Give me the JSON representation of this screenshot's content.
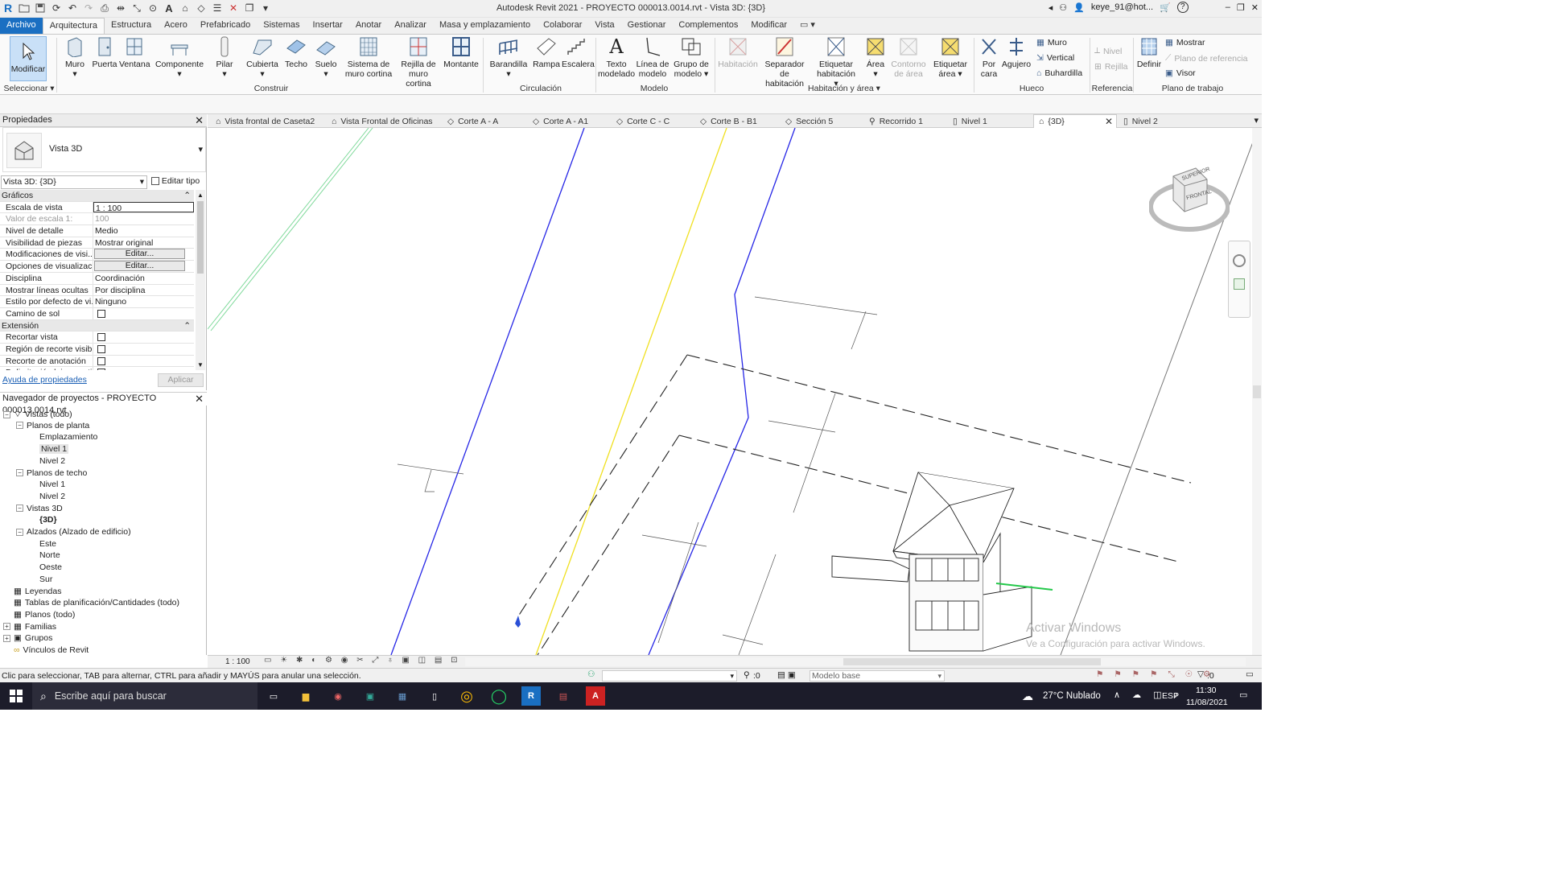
{
  "window": {
    "title": "Autodesk Revit 2021 - PROYECTO 000013.0014.rvt - Vista 3D: {3D}",
    "user": "keye_91@hot..."
  },
  "menu_tabs": [
    "Archivo",
    "Arquitectura",
    "Estructura",
    "Acero",
    "Prefabricado",
    "Sistemas",
    "Insertar",
    "Anotar",
    "Analizar",
    "Masa y emplazamiento",
    "Colaborar",
    "Vista",
    "Gestionar",
    "Complementos",
    "Modificar"
  ],
  "ribbon": {
    "modificar": "Modificar",
    "seleccionar": "Seleccionar",
    "construir": {
      "label": "Construir",
      "items": [
        "Muro",
        "Puerta",
        "Ventana",
        "Componente",
        "Pilar",
        "Cubierta",
        "Techo",
        "Suelo",
        "Sistema de muro cortina",
        "Rejilla de muro cortina",
        "Montante"
      ]
    },
    "circulacion": {
      "label": "Circulación",
      "items": [
        "Barandilla",
        "Rampa",
        "Escalera"
      ]
    },
    "modelo": {
      "label": "Modelo",
      "items": [
        "Texto modelado",
        "Línea de modelo",
        "Grupo de modelo"
      ]
    },
    "habitacion": {
      "label": "Habitación y área",
      "items": [
        "Habitación",
        "Separador de habitación",
        "Etiquetar habitación",
        "Área",
        "Contorno de área",
        "Etiquetar área"
      ]
    },
    "hueco": {
      "label": "Hueco",
      "items": [
        "Por cara",
        "Agujero"
      ],
      "small": [
        "Muro",
        "Vertical",
        "Buhardilla"
      ]
    },
    "referencia": {
      "label": "Referencia",
      "small": [
        "Nivel",
        "Rejilla"
      ]
    },
    "plano": {
      "label": "Plano de trabajo",
      "definir": "Definir",
      "small": [
        "Mostrar",
        "Plano de referencia",
        "Visor"
      ]
    }
  },
  "properties": {
    "header": "Propiedades",
    "type_name": "Vista 3D",
    "view_selector": "Vista 3D: {3D}",
    "edit_type": "Editar tipo",
    "help": "Ayuda de propiedades",
    "apply": "Aplicar",
    "rows": [
      {
        "cat": "Gráficos"
      },
      {
        "k": "Escala de vista",
        "v": "1 : 100"
      },
      {
        "k": "Valor de escala    1:",
        "v": "100",
        "dis": true
      },
      {
        "k": "Nivel de detalle",
        "v": "Medio"
      },
      {
        "k": "Visibilidad de piezas",
        "v": "Mostrar original"
      },
      {
        "k": "Modificaciones de visi...",
        "btn": "Editar..."
      },
      {
        "k": "Opciones de visualizaci...",
        "btn": "Editar..."
      },
      {
        "k": "Disciplina",
        "v": "Coordinación"
      },
      {
        "k": "Mostrar líneas ocultas",
        "v": "Por disciplina"
      },
      {
        "k": "Estilo por defecto de vi...",
        "v": "Ninguno"
      },
      {
        "k": "Camino de sol",
        "cb": true
      },
      {
        "cat": "Extensión"
      },
      {
        "k": "Recortar vista",
        "cb": true
      },
      {
        "k": "Región de recorte visible",
        "cb": true
      },
      {
        "k": "Recorte de anotación",
        "cb": true
      },
      {
        "k": "Delimitación lejana acti...",
        "cb": true
      }
    ]
  },
  "browser": {
    "header": "Navegador de proyectos - PROYECTO 000013.0014.rvt",
    "nodes": [
      {
        "label": "Vistas (todo)",
        "depth": 0,
        "tog": "-",
        "icon": "views"
      },
      {
        "label": "Planos de planta",
        "depth": 1,
        "tog": "-"
      },
      {
        "label": "Emplazamiento",
        "depth": 2
      },
      {
        "label": "Nivel 1",
        "depth": 2,
        "sel": true
      },
      {
        "label": "Nivel 2",
        "depth": 2
      },
      {
        "label": "Planos de techo",
        "depth": 1,
        "tog": "-"
      },
      {
        "label": "Nivel 1",
        "depth": 2
      },
      {
        "label": "Nivel 2",
        "depth": 2
      },
      {
        "label": "Vistas 3D",
        "depth": 1,
        "tog": "-"
      },
      {
        "label": "{3D}",
        "depth": 2,
        "bold": true
      },
      {
        "label": "Alzados (Alzado de edificio)",
        "depth": 1,
        "tog": "-"
      },
      {
        "label": "Este",
        "depth": 2
      },
      {
        "label": "Norte",
        "depth": 2
      },
      {
        "label": "Oeste",
        "depth": 2
      },
      {
        "label": "Sur",
        "depth": 2
      },
      {
        "label": "Leyendas",
        "depth": 0,
        "icon": "grid"
      },
      {
        "label": "Tablas de planificación/Cantidades (todo)",
        "depth": 0,
        "icon": "grid"
      },
      {
        "label": "Planos (todo)",
        "depth": 0,
        "icon": "grid"
      },
      {
        "label": "Familias",
        "depth": 0,
        "tog": "+",
        "icon": "grid"
      },
      {
        "label": "Grupos",
        "depth": 0,
        "tog": "+",
        "icon": "group"
      },
      {
        "label": "Vínculos de Revit",
        "depth": 0,
        "icon": "link"
      }
    ]
  },
  "view_tabs": [
    {
      "label": "Vista frontal de Caseta2",
      "icon": "elev"
    },
    {
      "label": "Vista Frontal de Oficinas",
      "icon": "elev"
    },
    {
      "label": "Corte A - A",
      "icon": "section"
    },
    {
      "label": "Corte A - A1",
      "icon": "section"
    },
    {
      "label": "Corte C - C",
      "icon": "section"
    },
    {
      "label": "Corte B - B1",
      "icon": "section"
    },
    {
      "label": "Sección 5",
      "icon": "section"
    },
    {
      "label": "Recorrido 1",
      "icon": "walk"
    },
    {
      "label": "Nivel 1",
      "icon": "plan"
    },
    {
      "label": "{3D}",
      "icon": "3d",
      "active": true
    },
    {
      "label": "Nivel 2",
      "icon": "plan"
    }
  ],
  "viewcube": {
    "top": "SUPERIOR",
    "front": "FRONTAL"
  },
  "view_control": {
    "scale": "1 : 100"
  },
  "status": {
    "hint": "Clic para seleccionar, TAB para alternar, CTRL para añadir y MAYÚS para anular una selección.",
    "count": ":0",
    "model": "Modelo base",
    "filter": ":0"
  },
  "watermark": {
    "line1": "Activar Windows",
    "line2": "Ve a Configuración para activar Windows."
  },
  "taskbar": {
    "search": "Escribe aquí para buscar",
    "weather": "27°C  Nublado",
    "lang": "ESP",
    "time": "11:30",
    "date": "11/08/2021"
  }
}
